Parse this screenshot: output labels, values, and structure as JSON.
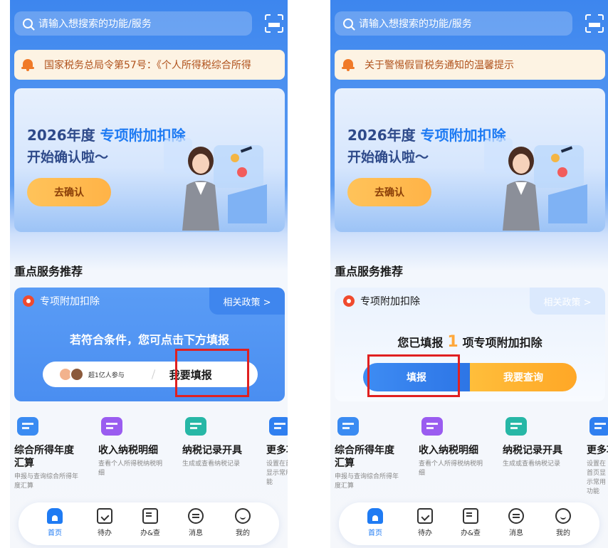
{
  "colors": {
    "primary": "#1f7bf3",
    "accent_orange": "#ffa726",
    "highlight_red": "#e02020"
  },
  "screens": [
    {
      "search_placeholder": "请输入想搜索的功能/服务",
      "notice": "国家税务总局令第57号：《个人所得税综合所得",
      "banner": {
        "year": "2026年度",
        "highlight": "专项附加扣除",
        "line2": "开始确认啦～",
        "button": "去确认"
      },
      "section_title": "重点服务推荐",
      "card": {
        "title": "专项附加扣除",
        "policy": "相关政策 >",
        "message": "若符合条件，您可点击下方填报",
        "participants": "超1亿人参与",
        "fill_button": "我要填报"
      },
      "services": [
        {
          "name": "综合所得年度汇算",
          "desc": "申报与查询综合所得年度汇算",
          "color": "#3a8bf2"
        },
        {
          "name": "收入纳税明细",
          "desc": "查看个人所得税纳税明细",
          "color": "#9a5cf0"
        },
        {
          "name": "纳税记录开具",
          "desc": "生成或查看纳税记录",
          "color": "#27b7a6"
        },
        {
          "name": "更多功能",
          "desc": "设置在首页显示常用功能",
          "color": "#2f7ff0"
        }
      ],
      "tabs": [
        "首页",
        "待办",
        "办&查",
        "消息",
        "我的"
      ]
    },
    {
      "search_placeholder": "请输入想搜索的功能/服务",
      "notice": "关于警惕假冒税务通知的温馨提示",
      "banner": {
        "year": "2026年度",
        "highlight": "专项附加扣除",
        "line2": "开始确认啦～",
        "button": "去确认"
      },
      "section_title": "重点服务推荐",
      "card": {
        "title": "专项附加扣除",
        "policy": "相关政策 >",
        "msg_prefix": "您已填报",
        "msg_count": "1",
        "msg_suffix": "项专项附加扣除",
        "fill_button": "填报",
        "query_button": "我要查询"
      },
      "services": [
        {
          "name": "综合所得年度汇算",
          "desc": "申报与查询综合所得年度汇算",
          "color": "#3a8bf2"
        },
        {
          "name": "收入纳税明细",
          "desc": "查看个人所得税纳税明细",
          "color": "#9a5cf0"
        },
        {
          "name": "纳税记录开具",
          "desc": "生成或查看纳税记录",
          "color": "#27b7a6"
        },
        {
          "name": "更多功能",
          "desc": "设置在首页显示常用功能",
          "color": "#2f7ff0"
        }
      ],
      "tabs": [
        "首页",
        "待办",
        "办&查",
        "消息",
        "我的"
      ]
    }
  ]
}
